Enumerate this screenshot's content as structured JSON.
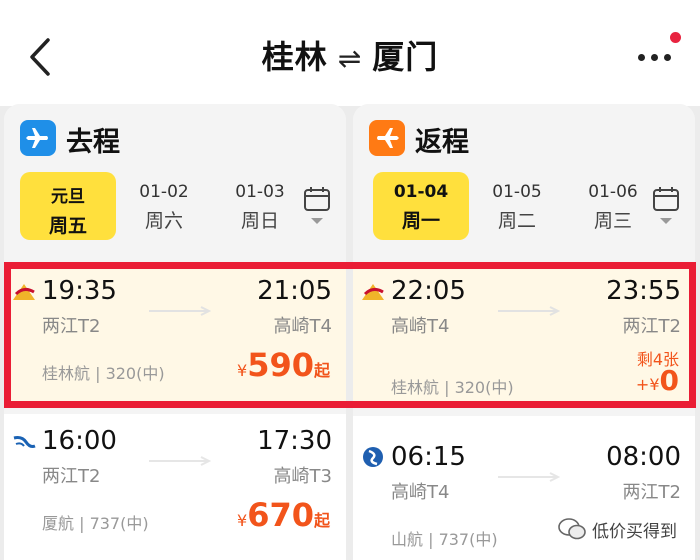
{
  "header": {
    "origin": "桂林",
    "swap_glyph": "⇌",
    "destination": "厦门"
  },
  "outbound": {
    "title": "去程",
    "dates": [
      {
        "line1": "元旦",
        "line2": "周五",
        "active": true
      },
      {
        "line1": "01-02",
        "line2": "周六",
        "active": false
      },
      {
        "line1": "01-03",
        "line2": "周日",
        "active": false
      }
    ],
    "flights": [
      {
        "dep_time": "19:35",
        "arr_time": "21:05",
        "dep_airport": "两江T2",
        "arr_airport": "高崎T4",
        "info": "桂林航 | 320(中)",
        "price_symbol": "¥",
        "price": "590",
        "price_suffix": "起",
        "selected": true
      },
      {
        "dep_time": "16:00",
        "arr_time": "17:30",
        "dep_airport": "两江T2",
        "arr_airport": "高崎T3",
        "info": "厦航 | 737(中)",
        "price_symbol": "¥",
        "price": "670",
        "price_suffix": "起",
        "selected": false
      }
    ]
  },
  "return": {
    "title": "返程",
    "dates": [
      {
        "line1": "01-04",
        "line2": "周一",
        "active": true
      },
      {
        "line1": "01-05",
        "line2": "周二",
        "active": false
      },
      {
        "line1": "01-06",
        "line2": "周三",
        "active": false
      }
    ],
    "flights": [
      {
        "dep_time": "22:05",
        "arr_time": "23:55",
        "dep_airport": "高崎T4",
        "arr_airport": "两江T2",
        "info": "桂林航 | 320(中)",
        "seats_left": "剩4张",
        "price_symbol": "+¥",
        "price": "0",
        "selected": true
      },
      {
        "dep_time": "06:15",
        "arr_time": "08:00",
        "dep_airport": "高崎T4",
        "arr_airport": "两江T2",
        "info": "山航 | 737(中)",
        "selected": false
      }
    ]
  },
  "watermark": "低价买得到",
  "colors": {
    "accent_red": "#ea1d35",
    "price_orange": "#f2541b",
    "date_yellow": "#ffe03d",
    "outbound_blue": "#1f8fe8",
    "return_orange": "#ff7a14"
  }
}
